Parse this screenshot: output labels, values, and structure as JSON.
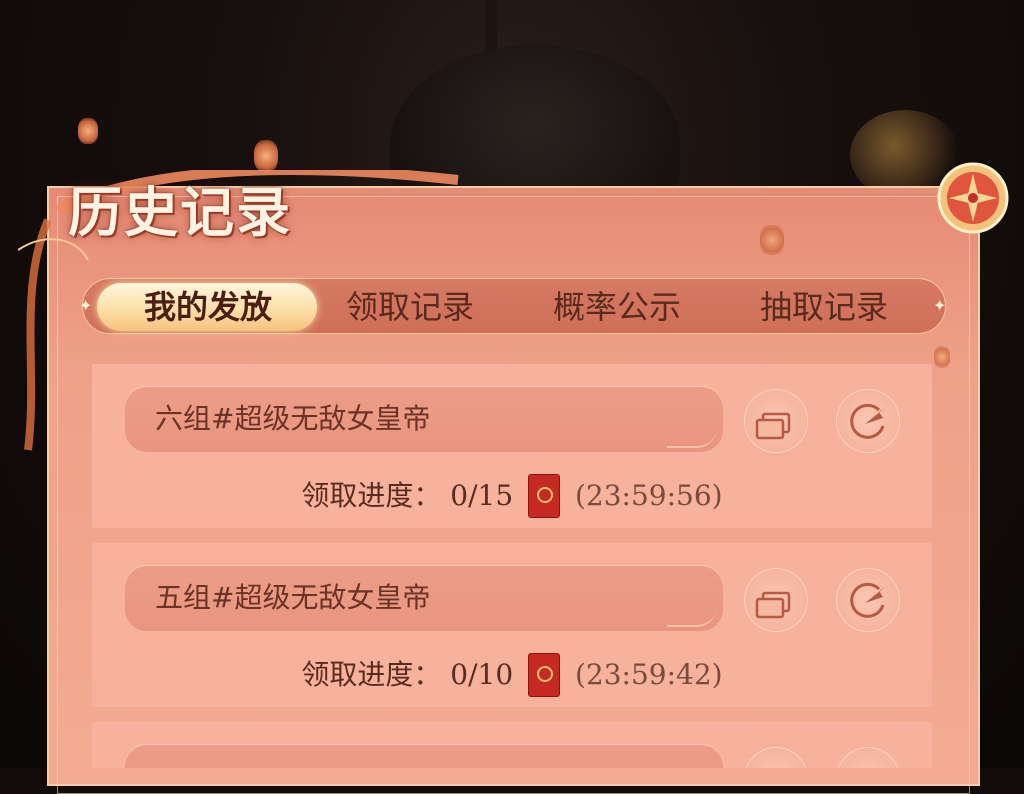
{
  "title": "历史记录",
  "tabs": [
    {
      "label": "我的发放",
      "active": true
    },
    {
      "label": "领取记录",
      "active": false
    },
    {
      "label": "概率公示",
      "active": false
    },
    {
      "label": "抽取记录",
      "active": false
    }
  ],
  "records": [
    {
      "name": "六组#超级无敌女皇帝",
      "progress_label": "领取进度：",
      "progress": "0/15",
      "countdown": "(23:59:56)"
    },
    {
      "name": "五组#超级无敌女皇帝",
      "progress_label": "领取进度：",
      "progress": "0/10",
      "countdown": "(23:59:42)"
    }
  ],
  "colors": {
    "panel": "#eea188",
    "card": "#f6b29c",
    "accent_gold": "#f6c27f",
    "text_dark": "#5a2c20"
  },
  "icons": {
    "copy": "copy-icon",
    "share": "share-arrow-icon",
    "redpacket": "red-envelope-icon",
    "medallion": "emblem-icon"
  }
}
